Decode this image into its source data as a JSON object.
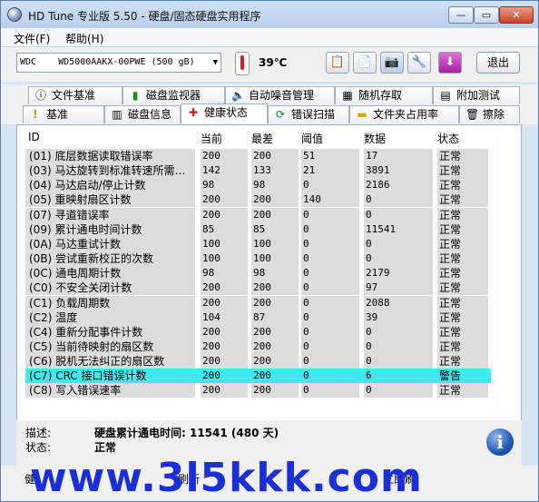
{
  "window": {
    "title": "HD Tune 专业版 5.50 - 硬盘/固态硬盘实用程序"
  },
  "titlebar": {
    "min_glyph": "—",
    "max_glyph": "▭",
    "close_glyph": "✕"
  },
  "menu": {
    "items": [
      "文件(F)",
      "帮助(H)"
    ]
  },
  "toolbar": {
    "drive": "WDC    WD5000AAKX-00PWE (500 gB)",
    "temperature": "39℃",
    "exit_label": "退出",
    "tools": [
      {
        "icon": "copy-info-icon",
        "glyph": "📋"
      },
      {
        "icon": "copy-screen-icon",
        "glyph": "📄"
      },
      {
        "icon": "camera-icon",
        "glyph": "📷"
      },
      {
        "icon": "options-icon",
        "glyph": "🔧"
      },
      {
        "icon": "download-icon",
        "glyph": "⬇"
      }
    ]
  },
  "tabs": {
    "row1": [
      {
        "label": "文件基准",
        "icon": "file-benchmark-icon",
        "glyph": "ⓘ"
      },
      {
        "label": "磁盘监视器",
        "icon": "disk-monitor-icon",
        "glyph": "▮"
      },
      {
        "label": "自动噪音管理",
        "icon": "speaker-icon",
        "glyph": "🔈"
      },
      {
        "label": "随机存取",
        "icon": "random-access-icon",
        "glyph": "▦"
      },
      {
        "label": "附加测试",
        "icon": "extra-tests-icon",
        "glyph": "▤"
      }
    ],
    "row2": [
      {
        "label": "基准",
        "icon": "benchmark-icon",
        "glyph": "!"
      },
      {
        "label": "磁盘信息",
        "icon": "disk-info-icon",
        "glyph": "▥"
      },
      {
        "label": "健康状态",
        "icon": "health-cross-icon",
        "glyph": "✚"
      },
      {
        "label": "错误扫描",
        "icon": "error-scan-icon",
        "glyph": "⟳"
      },
      {
        "label": "文件夹占用率",
        "icon": "folder-icon",
        "glyph": "▬"
      },
      {
        "label": "擦除",
        "icon": "trash-icon",
        "glyph": "🗑"
      }
    ]
  },
  "table": {
    "headers": [
      "ID",
      "当前",
      "最差",
      "阈值",
      "数据",
      "状态"
    ],
    "rows": [
      {
        "id": "(01) 底层数据读取错误率",
        "current": "200",
        "worst": "200",
        "threshold": "51",
        "data": "17",
        "status": "正常"
      },
      {
        "id": "(03) 马达旋转到标准转速所需…",
        "current": "142",
        "worst": "133",
        "threshold": "21",
        "data": "3891",
        "status": "正常"
      },
      {
        "id": "(04) 马达启动/停止计数",
        "current": "98",
        "worst": "98",
        "threshold": "0",
        "data": "2186",
        "status": "正常"
      },
      {
        "id": "(05) 重映射扇区计数",
        "current": "200",
        "worst": "200",
        "threshold": "140",
        "data": "0",
        "status": "正常"
      },
      {
        "id": "(07) 寻道错误率",
        "current": "200",
        "worst": "200",
        "threshold": "0",
        "data": "0",
        "status": "正常"
      },
      {
        "id": "(09) 累计通电时间计数",
        "current": "85",
        "worst": "85",
        "threshold": "0",
        "data": "11541",
        "status": "正常"
      },
      {
        "id": "(0A) 马达重试计数",
        "current": "100",
        "worst": "100",
        "threshold": "0",
        "data": "0",
        "status": "正常"
      },
      {
        "id": "(0B) 尝试重新校正的次数",
        "current": "100",
        "worst": "100",
        "threshold": "0",
        "data": "0",
        "status": "正常"
      },
      {
        "id": "(0C) 通电周期计数",
        "current": "98",
        "worst": "98",
        "threshold": "0",
        "data": "2179",
        "status": "正常"
      },
      {
        "id": "(C0) 不安全关闭计数",
        "current": "200",
        "worst": "200",
        "threshold": "0",
        "data": "97",
        "status": "正常"
      },
      {
        "id": "(C1) 负载周期数",
        "current": "200",
        "worst": "200",
        "threshold": "0",
        "data": "2088",
        "status": "正常"
      },
      {
        "id": "(C2) 温度",
        "current": "104",
        "worst": "87",
        "threshold": "0",
        "data": "39",
        "status": "正常"
      },
      {
        "id": "(C4) 重新分配事件计数",
        "current": "200",
        "worst": "200",
        "threshold": "0",
        "data": "0",
        "status": "正常"
      },
      {
        "id": "(C5) 当前待映射的扇区数",
        "current": "200",
        "worst": "200",
        "threshold": "0",
        "data": "0",
        "status": "正常"
      },
      {
        "id": "(C6) 脱机无法纠正的扇区数",
        "current": "200",
        "worst": "200",
        "threshold": "0",
        "data": "0",
        "status": "正常"
      },
      {
        "id": "(C7) CRC 接口错误计数",
        "current": "200",
        "worst": "200",
        "threshold": "0",
        "data": "6",
        "status": "警告",
        "warn": true
      },
      {
        "id": "(C8) 写入错误速率",
        "current": "200",
        "worst": "200",
        "threshold": "0",
        "data": "0",
        "status": "正常"
      }
    ]
  },
  "details": {
    "desc_label": "描述:",
    "desc_value": "硬盘累计通电时间: 11541 (480 天)",
    "status_label": "状态:",
    "status_value": "正常",
    "info_glyph": "i"
  },
  "bottom": {
    "left_fragment": "健",
    "refresh_fragment": "刷新",
    "now_fragment": "立即刷",
    "watermark": "www.3l5kkk.com",
    "highlight_color": "#3fe9ef"
  }
}
